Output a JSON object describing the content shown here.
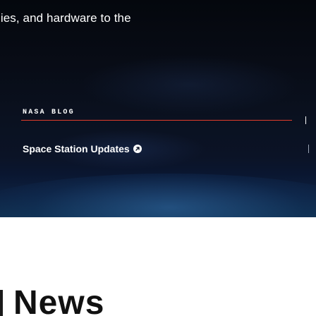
{
  "hero": {
    "description_fragment": "lies, and hardware to the"
  },
  "blog_card": {
    "label": "NASA BLOG",
    "title": "Space Station Updates",
    "title_icon": "arrow-circle-icon",
    "accent_color": "#e23c2c"
  },
  "news": {
    "heading": "News"
  }
}
